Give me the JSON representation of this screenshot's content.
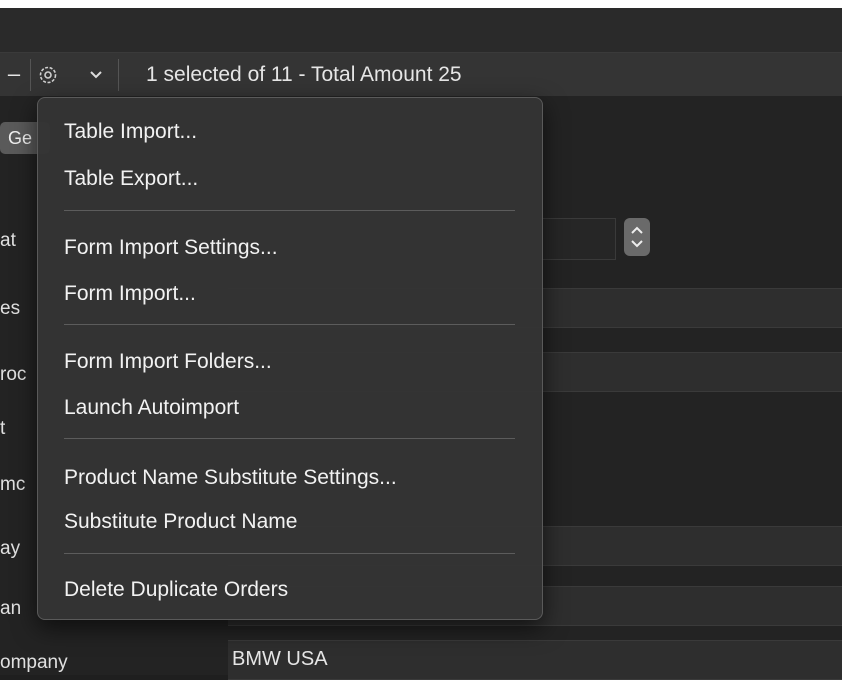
{
  "toolbar": {
    "minus_label": "–",
    "status": "1 selected of 11 - Total Amount 25",
    "gear_icon": "gear-icon",
    "chevron_icon": "chevron-down-icon"
  },
  "form": {
    "tab_label": "Ge",
    "labels": [
      "at",
      "es",
      "roc",
      "t",
      "mc",
      "ay",
      "an",
      "ompany"
    ],
    "company_value": "BMW USA"
  },
  "menu": {
    "items": [
      "Table Import...",
      "Table Export...",
      "Form Import Settings...",
      "Form Import...",
      "Form Import Folders...",
      "Launch Autoimport",
      "Product Name Substitute Settings...",
      "Substitute Product Name",
      "Delete Duplicate Orders"
    ]
  },
  "colors": {
    "menu_bg": "#343434",
    "toolbar_bg": "#343434",
    "window_bg": "#232323"
  }
}
